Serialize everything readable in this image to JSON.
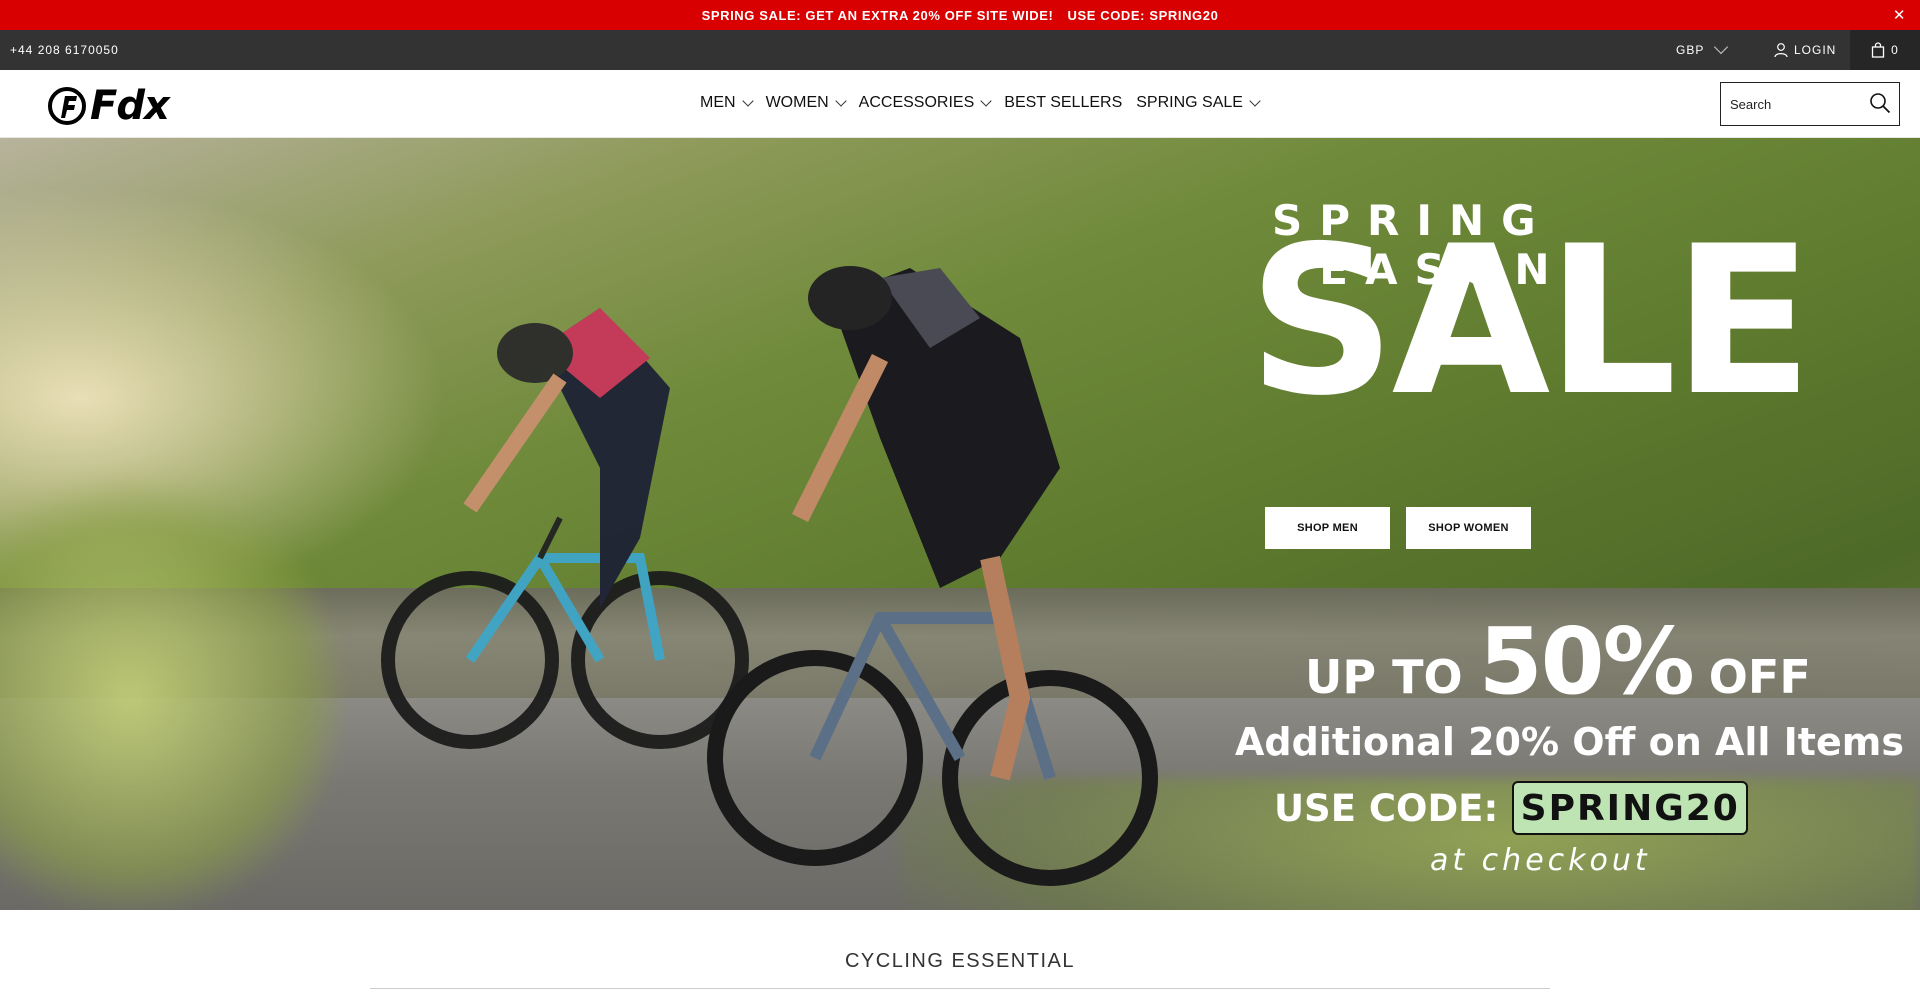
{
  "announcement": {
    "text": "SPRING SALE: GET AN EXTRA 20% OFF SITE WIDE!",
    "code_text": "USE CODE: SPRING20",
    "close_glyph": "✕"
  },
  "topbar": {
    "phone": "+44 208 6170050",
    "currency": "GBP",
    "login": "LOGIN",
    "cart_count": "0"
  },
  "header": {
    "logo_text": "Fdx",
    "nav": [
      {
        "label": "MEN"
      },
      {
        "label": "WOMEN"
      },
      {
        "label": "ACCESSORIES"
      },
      {
        "label": "BEST SELLERS"
      },
      {
        "label": "SPRING SALE"
      }
    ],
    "search_placeholder": "Search"
  },
  "hero": {
    "kicker": "SPRING SEASON",
    "headline": "SALE",
    "buttons": {
      "men": "SHOP MEN",
      "women": "SHOP WOMEN"
    },
    "upto_a": "UP TO",
    "upto_b": "50%",
    "upto_c": "OFF",
    "additional": "Additional 20% Off on All Items",
    "use_code_label": "USE CODE:",
    "code": "SPRING20",
    "checkout": "at checkout"
  },
  "section": {
    "title": "CYCLING ESSENTIAL"
  },
  "colors": {
    "announcement_bg": "#d80000",
    "topbar_bg": "#333333",
    "code_bg": "#bfe4b3"
  },
  "icons": [
    "close-icon",
    "chevron-down-icon",
    "user-icon",
    "bag-icon",
    "search-icon",
    "logo-f-icon"
  ]
}
